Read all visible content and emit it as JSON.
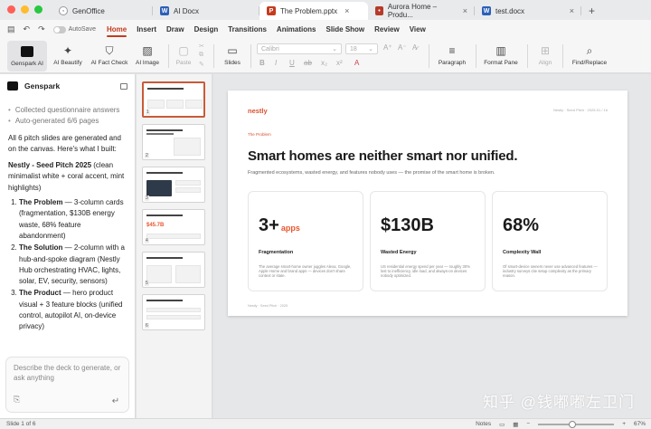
{
  "tabs": [
    {
      "icon": "office",
      "label": "GenOffice",
      "active": false
    },
    {
      "icon": "W",
      "label": "AI Docx",
      "active": false
    },
    {
      "icon": "P",
      "label": "The Problem.pptx",
      "active": true
    },
    {
      "icon": "web",
      "label": "Aurora Home – Produ...",
      "active": false
    },
    {
      "icon": "W",
      "label": "test.docx",
      "active": false
    }
  ],
  "autosave_label": "AutoSave",
  "menu": [
    "Home",
    "Insert",
    "Draw",
    "Design",
    "Transitions",
    "Animations",
    "Slide Show",
    "Review",
    "View"
  ],
  "active_menu": "Home",
  "toolbar": {
    "genspark_ai": "Genspark AI",
    "ai_beautify": "AI Beautify",
    "ai_fact_check": "AI Fact Check",
    "ai_image": "AI Image",
    "paste": "Paste",
    "slides": "Slides",
    "font_name": "Calibri",
    "font_size": "18",
    "paragraph": "Paragraph",
    "format_pane": "Format Pane",
    "align": "Align",
    "find_replace": "Find/Replace"
  },
  "assistant": {
    "title": "Genspark",
    "status_items": [
      "Collected questionnaire answers",
      "Auto-generated 6/6 pages"
    ],
    "intro": "All 6 pitch slides are generated and on the canvas. Here's what I built:",
    "deck_title": "Nestly - Seed Pitch 2025",
    "deck_desc": " (clean minimalist white + coral accent, mint highlights)",
    "items": [
      {
        "title": "The Problem",
        "text": " — 3-column cards (fragmentation, $130B energy waste, 68% feature abandonment)"
      },
      {
        "title": "The Solution",
        "text": " — 2-column with a hub-and-spoke diagram (Nestly Hub orchestrating HVAC, lights, solar, EV, security, sensors)"
      },
      {
        "title": "The Product",
        "text": " — hero product visual + 3 feature blocks (unified control, autopilot AI, on-device privacy)"
      }
    ],
    "input_placeholder": "Describe the deck to generate, or ask anything"
  },
  "thumbnails": [
    {
      "num": "1"
    },
    {
      "num": "2"
    },
    {
      "num": "3"
    },
    {
      "num": "4"
    },
    {
      "num": "5"
    },
    {
      "num": "6"
    }
  ],
  "slide": {
    "brand": "nestly",
    "meta": "Nestly · Seed Pitch · 2025-01 / 16",
    "section": "The Problem",
    "title": "Smart homes are neither smart nor unified.",
    "subtitle": "Fragmented ecosystems, wasted energy, and features nobody uses — the promise of the smart home is broken.",
    "cards": [
      {
        "stat": "3+",
        "stat_suffix": "apps",
        "label": "Fragmentation",
        "desc": "The average smart-home owner juggles Alexa, Google, Apple Home and brand apps — devices don't share context or state."
      },
      {
        "stat": "$130B",
        "stat_suffix": "",
        "label": "Wasted Energy",
        "desc": "US residential energy spend per year — roughly 30% lost to inefficiency, idle load, and always-on devices nobody optimized."
      },
      {
        "stat": "68%",
        "stat_suffix": "",
        "label": "Complexity Wall",
        "desc": "Of smart-device owners never use advanced features — industry surveys cite setup complexity as the primary reason."
      }
    ],
    "footer": "Nestly · Seed Pitch · 2025"
  },
  "watermark": "知乎 @钱嘟嘟左卫门",
  "status": {
    "slide_info": "Slide 1 of 6",
    "notes": "Notes",
    "zoom": "67%",
    "zoom_level": 0.67
  },
  "colors": {
    "accent": "#c43b1e",
    "brand_coral": "#e8562f"
  }
}
